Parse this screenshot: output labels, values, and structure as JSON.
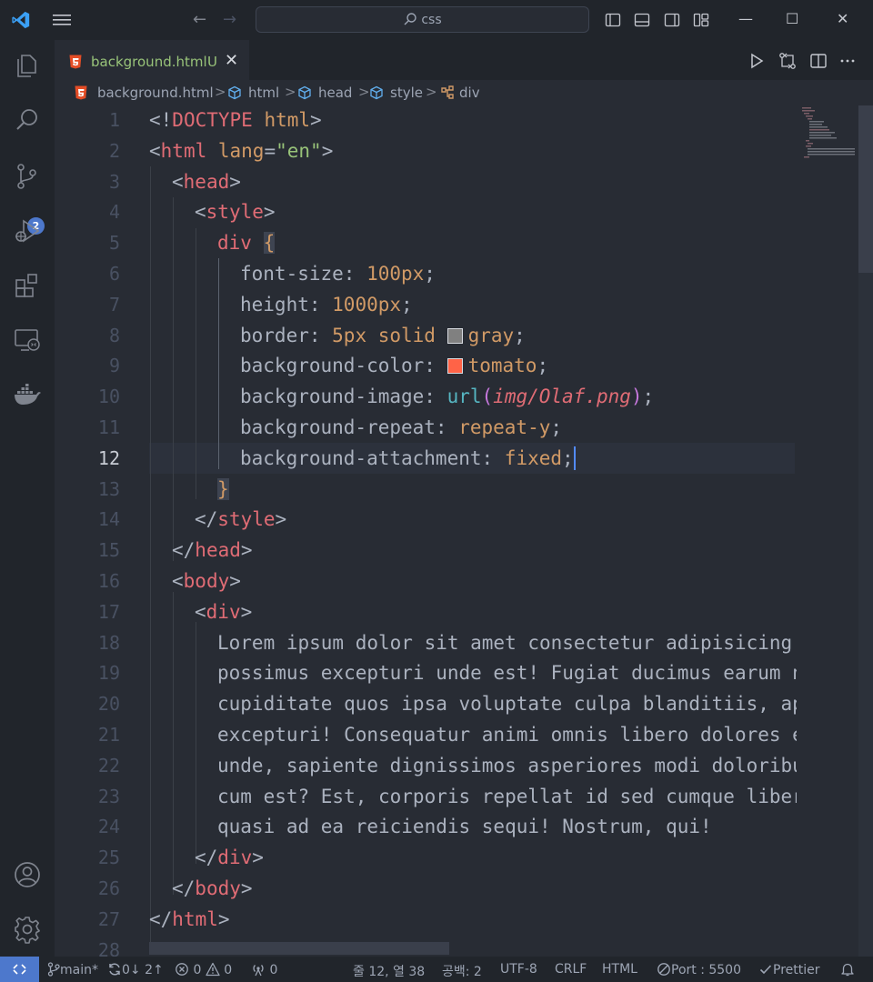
{
  "titlebar": {
    "search_text": "css",
    "back_glyph": "←",
    "forward_glyph": "→",
    "minimize_glyph": "—",
    "maximize_glyph": "☐",
    "close_glyph": "✕"
  },
  "activity_bar": {
    "items": [
      "explorer-icon",
      "search-icon",
      "source-control-icon",
      "run-debug-icon",
      "extensions-icon",
      "remote-explorer-icon",
      "docker-icon"
    ],
    "source_control_badge": "2",
    "bottom_items": [
      "accounts-icon",
      "settings-gear-icon"
    ]
  },
  "tabs": [
    {
      "label": "background.html",
      "status": "U",
      "close": "✕"
    }
  ],
  "breadcrumb": {
    "items": [
      "background.html",
      "html",
      "head",
      "style",
      "div"
    ],
    "separator": ">"
  },
  "editor": {
    "active_line": 12,
    "line_numbers": [
      "1",
      "2",
      "3",
      "4",
      "5",
      "6",
      "7",
      "8",
      "9",
      "10",
      "11",
      "12",
      "13",
      "14",
      "15",
      "16",
      "17",
      "18",
      "19",
      "20",
      "21",
      "22",
      "23",
      "24",
      "25",
      "26",
      "27",
      "28"
    ],
    "lines": {
      "l1": {
        "a": "<!",
        "b": "DOCTYPE",
        "c": " html",
        "d": ">"
      },
      "l2": {
        "a": "<",
        "b": "html",
        "c": " lang",
        "d": "=",
        "e": "\"en\"",
        "f": ">"
      },
      "l3": {
        "a": "<",
        "b": "head",
        "c": ">"
      },
      "l4": {
        "a": "<",
        "b": "style",
        "c": ">"
      },
      "l5": {
        "a": "div",
        "b": " ",
        "c": "{"
      },
      "l6": {
        "a": "font-size: ",
        "b": "100px",
        "c": ";"
      },
      "l7": {
        "a": "height: ",
        "b": "1000px",
        "c": ";"
      },
      "l8": {
        "a": "border: ",
        "b": "5px solid ",
        "c": "gray",
        "d": ";"
      },
      "l9": {
        "a": "background-color: ",
        "b": "tomato",
        "c": ";"
      },
      "l10": {
        "a": "background-image: ",
        "b": "url",
        "c": "(",
        "d": "img/Olaf.png",
        "e": ")",
        "f": ";"
      },
      "l11": {
        "a": "background-repeat: ",
        "b": "repeat-y",
        "c": ";"
      },
      "l12": {
        "a": "background-attachment: ",
        "b": "fixed",
        "c": ";"
      },
      "l13": {
        "a": "}"
      },
      "l14": {
        "a": "</",
        "b": "style",
        "c": ">"
      },
      "l15": {
        "a": "</",
        "b": "head",
        "c": ">"
      },
      "l16": {
        "a": "<",
        "b": "body",
        "c": ">"
      },
      "l17": {
        "a": "<",
        "b": "div",
        "c": ">"
      },
      "l18": "Lorem ipsum dolor sit amet consectetur adipisicing",
      "l19": "possimus excepturi unde est! Fugiat ducimus earum n",
      "l20": "cupiditate quos ipsa voluptate culpa blanditiis, ap",
      "l21": "excepturi! Consequatur animi omnis libero dolores e",
      "l22": "unde, sapiente dignissimos asperiores modi doloribu",
      "l23": "cum est? Est, corporis repellat id sed cumque liber",
      "l24": "quasi ad ea reiciendis sequi! Nostrum, qui!",
      "l25": {
        "a": "</",
        "b": "div",
        "c": ">"
      },
      "l26": {
        "a": "</",
        "b": "body",
        "c": ">"
      },
      "l27": {
        "a": "</",
        "b": "html",
        "c": ">"
      }
    },
    "colors": {
      "gray_swatch": "#808080",
      "tomato_swatch": "#ff6347"
    }
  },
  "statusbar": {
    "branch": "main*",
    "sync": "0↓ 2↑",
    "errors": "0",
    "warnings": "0",
    "ports": "0",
    "position": "줄 12, 열 38",
    "spaces": "공백: 2",
    "encoding": "UTF-8",
    "eol": "CRLF",
    "language": "HTML",
    "port_label": "Port : 5500",
    "prettier": "Prettier"
  }
}
